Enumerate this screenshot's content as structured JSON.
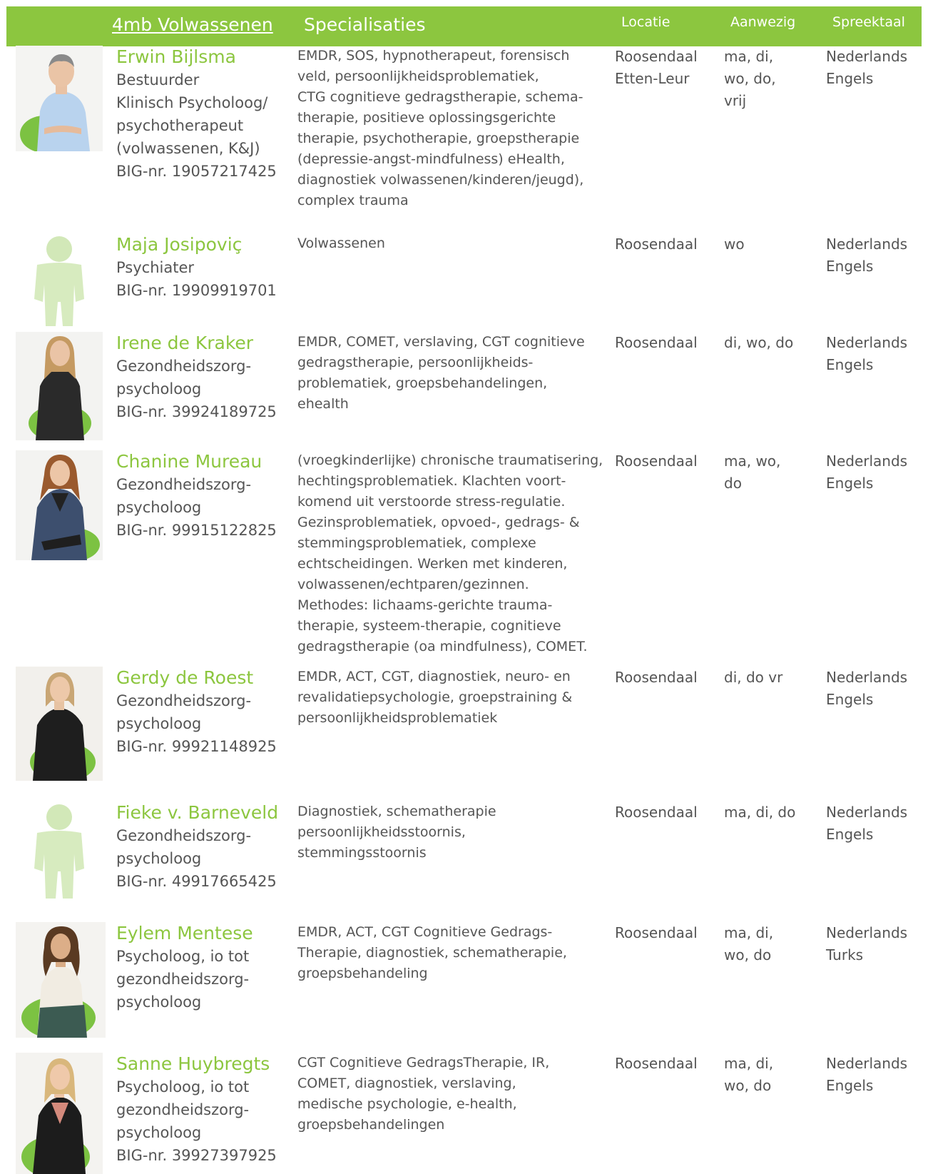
{
  "header": {
    "title": "4mb Volwassenen",
    "specialisaties": "Specialisaties",
    "locatie": "Locatie",
    "aanwezig": "Aanwezig",
    "spreektaal": "Spreektaal"
  },
  "colors": {
    "brand_green": "#8cc63f",
    "text_gray": "#555555"
  },
  "people": [
    {
      "name": "Erwin Bijlsma",
      "role_lines": [
        "Bestuurder",
        "Klinisch Psycholoog/",
        "psychotherapeut",
        "(volwassenen, K&J)"
      ],
      "big": "BIG-nr. 19057217425",
      "spec_lines": [
        "EMDR, SOS, hypnotherapeut, forensisch",
        "veld, persoonlijkheidsproblematiek,",
        "CTG cognitieve gedragstherapie, schema-",
        "therapie, positieve oplossingsgerichte",
        "therapie, psychotherapie, groepstherapie",
        "(depressie-angst-mindfulness) eHealth,",
        "diagnostiek volwassenen/kinderen/jeugd),",
        "complex trauma"
      ],
      "locatie": [
        "Roosendaal",
        "Etten-Leur"
      ],
      "aanwezig": [
        "ma, di,",
        "wo, do,",
        "vrij"
      ],
      "talen": [
        "Nederlands",
        "Engels"
      ]
    },
    {
      "name": "Maja Josipoviç",
      "role_lines": [
        "Psychiater"
      ],
      "big": "BIG-nr. 19909919701",
      "spec_lines": [
        "Volwassenen"
      ],
      "locatie": [
        "Roosendaal"
      ],
      "aanwezig": [
        "wo"
      ],
      "talen": [
        "Nederlands",
        "Engels"
      ]
    },
    {
      "name": "Irene de Kraker",
      "role_lines": [
        "Gezondheidszorg-",
        "psycholoog"
      ],
      "big": "BIG-nr. 39924189725",
      "spec_lines": [
        "EMDR, COMET, verslaving, CGT cognitieve",
        "gedragstherapie, persoonlijkheids-",
        "problematiek, groepsbehandelingen,",
        "ehealth"
      ],
      "locatie": [
        "Roosendaal"
      ],
      "aanwezig": [
        "di, wo, do"
      ],
      "talen": [
        "Nederlands",
        "Engels"
      ]
    },
    {
      "name": "Chanine Mureau",
      "role_lines": [
        "Gezondheidszorg-",
        "psycholoog"
      ],
      "big": "BIG-nr. 99915122825",
      "spec_lines": [
        "(vroegkinderlijke) chronische traumatisering,",
        "hechtingsproblematiek. Klachten voort-",
        "komend uit verstoorde stress-regulatie.",
        "Gezinsproblematiek, opvoed-, gedrags- &",
        "stemmingsproblematiek, complexe",
        "echtscheidingen. Werken met kinderen,",
        "volwassenen/echtparen/gezinnen.",
        "Methodes: lichaams-gerichte trauma-",
        "therapie, systeem-therapie, cognitieve",
        "gedragstherapie (oa mindfulness), COMET."
      ],
      "locatie": [
        "Roosendaal"
      ],
      "aanwezig": [
        "ma, wo,",
        "do"
      ],
      "talen": [
        "Nederlands",
        "Engels"
      ]
    },
    {
      "name": "Gerdy de Roest",
      "role_lines": [
        "Gezondheidszorg-",
        "psycholoog"
      ],
      "big": "BIG-nr. 99921148925",
      "spec_lines": [
        "EMDR, ACT, CGT, diagnostiek, neuro- en",
        "revalidatiepsychologie, groepstraining &",
        "persoonlijkheidsproblematiek"
      ],
      "locatie": [
        "Roosendaal"
      ],
      "aanwezig": [
        "di, do vr"
      ],
      "talen": [
        "Nederlands",
        "Engels"
      ]
    },
    {
      "name": "Fieke v. Barneveld",
      "role_lines": [
        "Gezondheidszorg-",
        "psycholoog"
      ],
      "big": "BIG-nr. 49917665425",
      "spec_lines": [
        "Diagnostiek, schematherapie",
        "persoonlijkheidsstoornis,",
        "stemmingsstoornis"
      ],
      "locatie": [
        "Roosendaal"
      ],
      "aanwezig": [
        "ma, di, do"
      ],
      "talen": [
        "Nederlands",
        "Engels"
      ]
    },
    {
      "name": "Eylem Mentese",
      "role_lines": [
        "Psycholoog, io tot",
        "gezondheidszorg-",
        "psycholoog"
      ],
      "big": "",
      "spec_lines": [
        "EMDR, ACT, CGT Cognitieve Gedrags-",
        "Therapie, diagnostiek, schematherapie,",
        "groepsbehandeling"
      ],
      "locatie": [
        "Roosendaal"
      ],
      "aanwezig": [
        "ma, di,",
        "wo, do"
      ],
      "talen": [
        "Nederlands",
        "Turks"
      ]
    },
    {
      "name": "Sanne Huybregts",
      "role_lines": [
        "Psycholoog, io tot",
        "gezondheidszorg-",
        "psycholoog"
      ],
      "big": " BIG-nr. 39927397925",
      "spec_lines": [
        "CGT Cognitieve GedragsTherapie, IR,",
        "COMET, diagnostiek, verslaving,",
        "medische psychologie, e-health,",
        "groepsbehandelingen"
      ],
      "locatie": [
        "Roosendaal"
      ],
      "aanwezig": [
        "ma, di,",
        "wo, do"
      ],
      "talen": [
        "Nederlands",
        "Engels"
      ]
    }
  ]
}
